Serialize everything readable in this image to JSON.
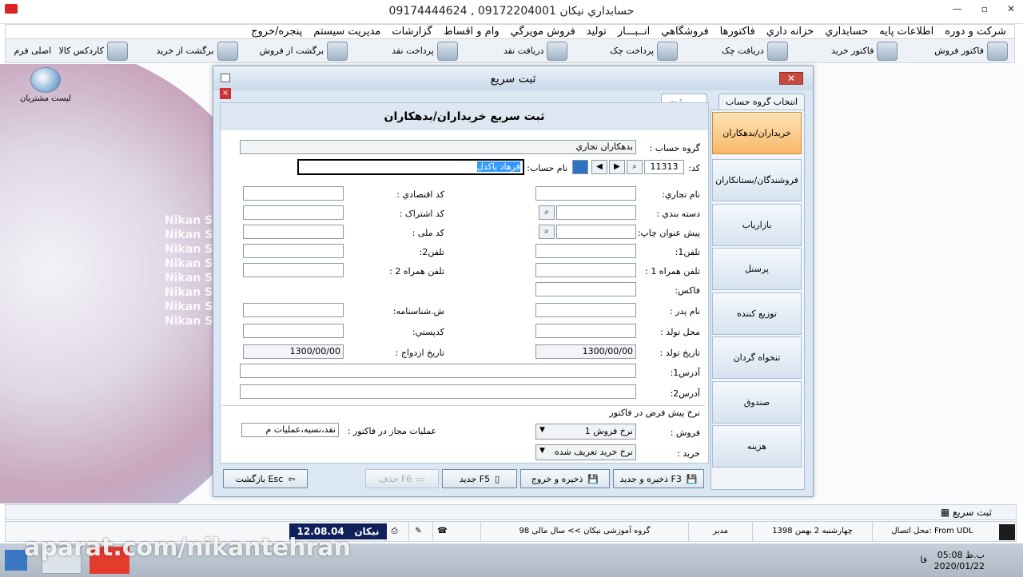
{
  "window": {
    "title": "حسابداري نيكان 09172204001 , 09174444624",
    "minimize": "—",
    "restore": "▫",
    "close": "✕"
  },
  "menu": [
    "شرکت و دوره",
    "اطلاعات پايه",
    "حسابداري",
    "خزانه داري",
    "فاکتورها",
    "فروشگاهي",
    "انــبـــار",
    "توليد",
    "فروش مويرگي",
    "وام و اقساط",
    "گزارشات",
    "مديريت سيستم",
    "پنجره/خروج"
  ],
  "toolbar": [
    "فاکتور فروش",
    "فاکتور خريد",
    "دريافت چک",
    "پرداخت چک",
    "دريافت نقد",
    "پرداخت نقد",
    "برگشت از فروش",
    "برگشت از خريد",
    "کاردکس کالا",
    "اصلی فرم"
  ],
  "desktop": {
    "icon_label": "ليست مشتريان",
    "watermark": "Nikan Soft"
  },
  "dialog": {
    "title": "ثبت سريع",
    "tab_select_group": "انتخاب گروه حساب",
    "tab_quick": "ثبت سريع",
    "header": "ثبت سريع خريداران/بدهکاران",
    "side_buttons": [
      "خريداران/بدهکاران",
      "فروشندگان/بستانکاران",
      "بازارياب",
      "پرسنل",
      "توزيع کننده",
      "تنخواه گردان",
      "صندوق",
      "هزينه"
    ],
    "fields": {
      "group_label": "گروه حساب :",
      "group_value": "بدهکاران تجاري",
      "code_label": "کد:",
      "code_value": "11313",
      "name_label": "نام حساب:",
      "name_value": "فرهاد پاکدل",
      "trade_name": "نام تجاري:",
      "category": "دسته بندي :",
      "print_title": "پيش عنوان چاپ:",
      "phone1": "تلفن1:",
      "mobile1": "تلفن همراه 1 :",
      "fax": "فاکس:",
      "father": "نام پدر :",
      "birth_place": "محل تولد :",
      "birth_date": "تاريخ تولد :",
      "birth_date_value": "1300/00/00",
      "econ_code": "کد اقتصادي :",
      "sub_code": "کد اشتراک :",
      "national_code": "کد ملی :",
      "phone2": "تلفن2:",
      "mobile2": "تلفن همراه 2 :",
      "id_no": "ش.شناسنامه:",
      "postal": "کدپستي:",
      "marriage_date": "تاريخ ازدواج :",
      "marriage_date_value": "1300/00/00",
      "address1": "آدرس1:",
      "address2": "آدرس2:",
      "rates_title": "نرخ پيش فرض در فاکتور",
      "sale_label": "فروش :",
      "sale_value": "نرخ فروش 1",
      "buy_label": "خريد :",
      "buy_value": "نرخ خريد تعريف شده",
      "ops_label": "عمليات مجاز در فاکتور :",
      "ops_value": "نقد،نسيه،عمليات م"
    },
    "buttons": {
      "save_new": "ذخيره و جديد F3",
      "save_exit": "ذخيره و خروج",
      "new": "جديد F5",
      "delete": "حذف F6",
      "back": "بازگشت Esc"
    }
  },
  "status": {
    "active_form": "ثبت سريع",
    "conn": "محل اتصال: From UDL",
    "date": "چهارشنبه 2 بهمن 1398",
    "user": "مدير",
    "org": "گروه آموزشی نيکان >> سال مالی 98",
    "brand": "نيکان",
    "version": "12.08.04"
  },
  "overlay": {
    "watermark": "aparat.com/nikantehran"
  },
  "taskbar": {
    "time": "05:08 ب.ظ",
    "date": "2020/01/22",
    "lang": "فا"
  }
}
